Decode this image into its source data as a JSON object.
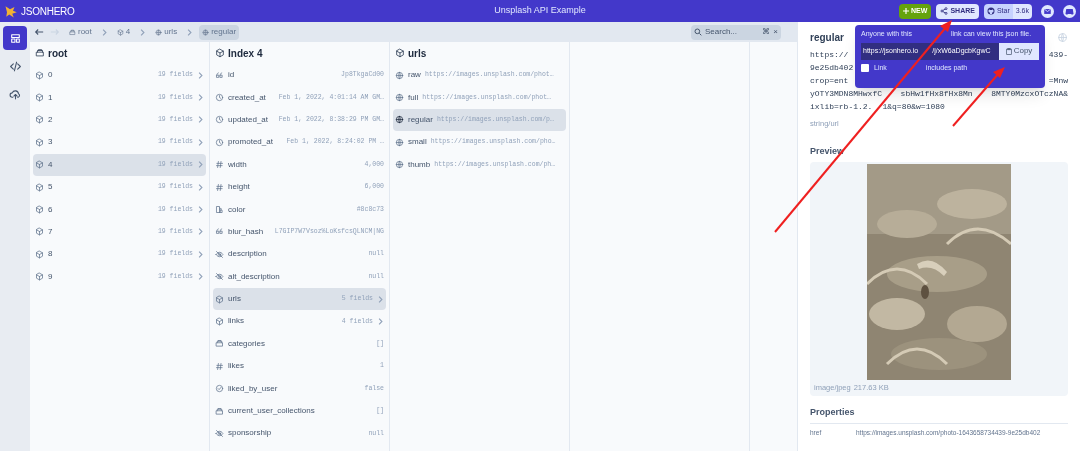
{
  "app": {
    "logo": "JSONHERO",
    "title": "Unsplash API Example"
  },
  "top_actions": {
    "new": "NEW",
    "share": "SHARE",
    "star": "Star",
    "star_count": "3.6k"
  },
  "rail": [
    {
      "selected": true
    },
    {
      "selected": false
    },
    {
      "selected": false
    }
  ],
  "breadcrumbs": [
    {
      "kind": "array",
      "label": "root",
      "selected": false
    },
    {
      "kind": "object",
      "label": "4",
      "selected": false
    },
    {
      "kind": "url",
      "label": "urls",
      "selected": false
    },
    {
      "kind": "url",
      "label": "regular",
      "selected": true
    }
  ],
  "search": {
    "placeholder": "Search...",
    "shortcut": "⌘",
    "clear": "×"
  },
  "columns": [
    {
      "kind": "array",
      "title": "root",
      "items": [
        {
          "kind": "object",
          "key": "0",
          "value": "19 fields",
          "expandable": true,
          "selected": false
        },
        {
          "kind": "object",
          "key": "1",
          "value": "19 fields",
          "expandable": true,
          "selected": false
        },
        {
          "kind": "object",
          "key": "2",
          "value": "19 fields",
          "expandable": true,
          "selected": false
        },
        {
          "kind": "object",
          "key": "3",
          "value": "19 fields",
          "expandable": true,
          "selected": false
        },
        {
          "kind": "object",
          "key": "4",
          "value": "19 fields",
          "expandable": true,
          "selected": true
        },
        {
          "kind": "object",
          "key": "5",
          "value": "19 fields",
          "expandable": true,
          "selected": false
        },
        {
          "kind": "object",
          "key": "6",
          "value": "19 fields",
          "expandable": true,
          "selected": false
        },
        {
          "kind": "object",
          "key": "7",
          "value": "19 fields",
          "expandable": true,
          "selected": false
        },
        {
          "kind": "object",
          "key": "8",
          "value": "19 fields",
          "expandable": true,
          "selected": false
        },
        {
          "kind": "object",
          "key": "9",
          "value": "19 fields",
          "expandable": true,
          "selected": false
        }
      ]
    },
    {
      "kind": "object",
      "title": "Index 4",
      "items": [
        {
          "kind": "string",
          "key": "id",
          "value": "Jp8TkgaCd00",
          "expandable": false,
          "selected": false
        },
        {
          "kind": "date",
          "key": "created_at",
          "value": "Feb 1, 2022, 4:01:14 AM GM…",
          "expandable": false,
          "selected": false
        },
        {
          "kind": "date",
          "key": "updated_at",
          "value": "Feb 1, 2022, 8:38:29 PM GM…",
          "expandable": false,
          "selected": false
        },
        {
          "kind": "date",
          "key": "promoted_at",
          "value": "Feb 1, 2022, 8:24:02 PM …",
          "expandable": false,
          "selected": false
        },
        {
          "kind": "number",
          "key": "width",
          "value": "4,000",
          "expandable": false,
          "selected": false
        },
        {
          "kind": "number",
          "key": "height",
          "value": "6,000",
          "expandable": false,
          "selected": false
        },
        {
          "kind": "color",
          "key": "color",
          "value": "#8c8c73",
          "expandable": false,
          "selected": false
        },
        {
          "kind": "string",
          "key": "blur_hash",
          "value": "L7GIP7W7Vsoz%LoKsfcsQLNCM|NG",
          "expandable": false,
          "selected": false
        },
        {
          "kind": "null",
          "key": "description",
          "value": "null",
          "expandable": false,
          "selected": false
        },
        {
          "kind": "null",
          "key": "alt_description",
          "value": "null",
          "expandable": false,
          "selected": false
        },
        {
          "kind": "object",
          "key": "urls",
          "value": "5 fields",
          "expandable": true,
          "selected": true
        },
        {
          "kind": "object",
          "key": "links",
          "value": "4 fields",
          "expandable": true,
          "selected": false
        },
        {
          "kind": "array",
          "key": "categories",
          "value": "[]",
          "expandable": false,
          "selected": false
        },
        {
          "kind": "number",
          "key": "likes",
          "value": "1",
          "expandable": false,
          "selected": false
        },
        {
          "kind": "boolean",
          "key": "liked_by_user",
          "value": "false",
          "expandable": false,
          "selected": false
        },
        {
          "kind": "array",
          "key": "current_user_collections",
          "value": "[]",
          "expandable": false,
          "selected": false
        },
        {
          "kind": "null",
          "key": "sponsorship",
          "value": "null",
          "expandable": false,
          "selected": false
        }
      ]
    },
    {
      "kind": "object",
      "title": "urls",
      "items": [
        {
          "kind": "url",
          "key": "raw",
          "value": "https://images.unsplash.com/phot…",
          "expandable": false,
          "selected": false
        },
        {
          "kind": "url",
          "key": "full",
          "value": "https://images.unsplash.com/phot…",
          "expandable": false,
          "selected": false
        },
        {
          "kind": "url",
          "key": "regular",
          "value": "https://images.unsplash.com/p…",
          "expandable": false,
          "selected": true
        },
        {
          "kind": "url",
          "key": "small",
          "value": "https://images.unsplash.com/pho…",
          "expandable": false,
          "selected": false
        },
        {
          "kind": "url",
          "key": "thumb",
          "value": "https://images.unsplash.com/ph…",
          "expandable": false,
          "selected": false
        }
      ]
    }
  ],
  "detail": {
    "title": "regular",
    "value_lines": [
      {
        "parts": [
          "https://"
        ],
        "right": "439-"
      },
      {
        "parts": [
          "9e25db402"
        ]
      },
      {
        "parts": [
          "crop=ent"
        ],
        "right": "=Mnw"
      },
      {
        "parts": [
          "yOTY3MDN8MHwxfC",
          "sbHw1fHx8fHx8Mn",
          "8MTY0MzcxOTczNA&"
        ]
      },
      {
        "parts": [
          "ixlib=rb-1.2.",
          "1&q=80&w=1080"
        ]
      }
    ],
    "type": "string/url",
    "preview_heading": "Preview",
    "preview": {
      "kind": "picture",
      "mime": "image/jpeg",
      "size": "217.63 KB"
    },
    "properties_heading": "Properties",
    "properties": [
      {
        "name": "href",
        "value": "https://images.unsplash.com/photo-1643658734439-9e25db402"
      }
    ]
  },
  "share_popup": {
    "message": [
      "Anyone with this",
      "link can view this json file."
    ],
    "link": [
      "https://jsonhero.io",
      "/j/xW6aDgcbKgwC"
    ],
    "copy": "Copy",
    "option": {
      "label": [
        "Link",
        "includes path"
      ],
      "checked": false
    }
  }
}
